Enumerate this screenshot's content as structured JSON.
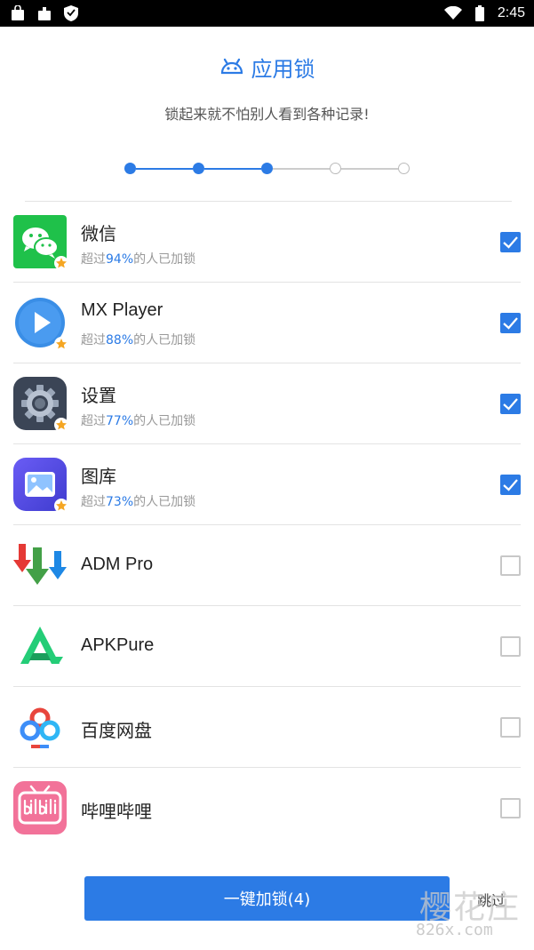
{
  "status_bar": {
    "time": "2:45"
  },
  "header": {
    "title": "应用锁",
    "subtitle": "锁起来就不怕别人看到各种记录!"
  },
  "stepper": {
    "total_steps": 5,
    "completed_steps": 3
  },
  "apps": [
    {
      "name": "微信",
      "stat_prefix": "超过",
      "stat_percent": "94%",
      "stat_suffix": "的人已加锁",
      "checked": true,
      "recommended": true,
      "icon": "wechat-icon"
    },
    {
      "name": "MX Player",
      "stat_prefix": "超过",
      "stat_percent": "88%",
      "stat_suffix": "的人已加锁",
      "checked": true,
      "recommended": true,
      "icon": "mx-player-icon"
    },
    {
      "name": "设置",
      "stat_prefix": "超过",
      "stat_percent": "77%",
      "stat_suffix": "的人已加锁",
      "checked": true,
      "recommended": true,
      "icon": "settings-gear-icon"
    },
    {
      "name": "图库",
      "stat_prefix": "超过",
      "stat_percent": "73%",
      "stat_suffix": "的人已加锁",
      "checked": true,
      "recommended": true,
      "icon": "gallery-icon"
    },
    {
      "name": "ADM Pro",
      "checked": false,
      "recommended": false,
      "icon": "adm-pro-icon"
    },
    {
      "name": "APKPure",
      "checked": false,
      "recommended": false,
      "icon": "apkpure-icon"
    },
    {
      "name": "百度网盘",
      "checked": false,
      "recommended": false,
      "icon": "baidu-netdisk-icon"
    },
    {
      "name": "哔哩哔哩",
      "checked": false,
      "recommended": false,
      "icon": "bilibili-icon"
    }
  ],
  "actions": {
    "lock_button_label": "一键加锁(4)",
    "skip_label": "跳过"
  },
  "watermark": {
    "main": "樱花庄",
    "sub": "826x.com"
  },
  "colors": {
    "accent": "#2c7be5",
    "checkbox_border": "#c8c8c8",
    "divider": "#e3e3e3"
  }
}
